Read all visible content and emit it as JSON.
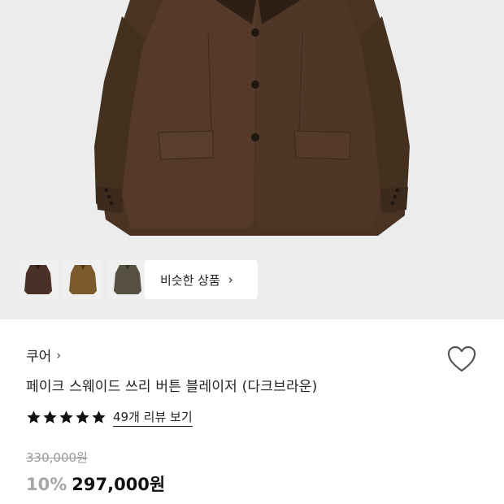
{
  "gallery": {
    "main_image": "brown-blazer-photo",
    "thumbnails": [
      {
        "name": "thumbnail-dark-brown",
        "color": "#4a3026"
      },
      {
        "name": "thumbnail-camel",
        "color": "#7a5a2a"
      },
      {
        "name": "thumbnail-olive",
        "color": "#55503f"
      }
    ],
    "similar_button_label": "비슷한 상품",
    "similar_button_icon": "chevron-right-icon"
  },
  "product": {
    "brand": "쿠어",
    "brand_icon": "chevron-right-icon",
    "title": "페이크 스웨이드 쓰리 버튼 블레이저 (다크브라운)",
    "rating_stars": 5,
    "review_link": "49개 리뷰 보기",
    "original_price": "330,000원",
    "discount": "10%",
    "price": "297,000원",
    "wishlist_icon": "heart-outline-icon"
  },
  "colors": {
    "jacket": "#4b3324",
    "star": "#111111",
    "discount": "#a6a6a6"
  }
}
